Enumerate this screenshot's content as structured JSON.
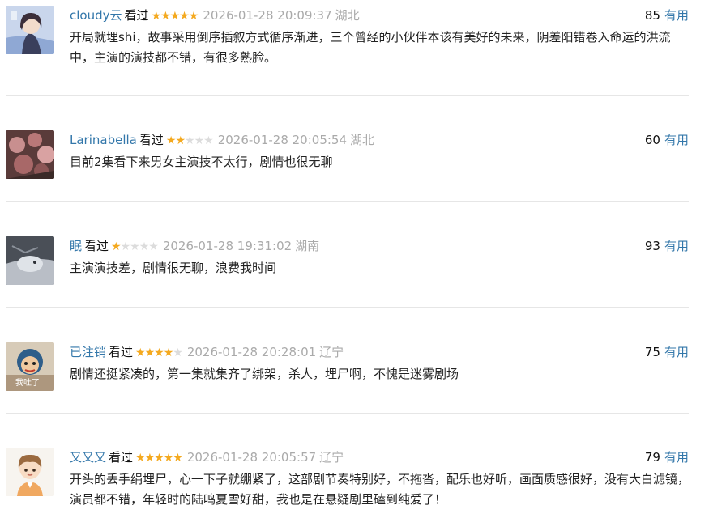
{
  "comments": [
    {
      "user": "cloudy云",
      "watched": "看过",
      "rating": 5,
      "time": "2026-01-28 20:09:37",
      "location": "湖北",
      "votes": "85",
      "useful_label": "有用",
      "content": "开局就埋shi，故事采用倒序插叙方式循序渐进，三个曾经的小伙伴本该有美好的未来，阴差阳错卷入命运的洪流中，主演的演技都不错，有很多熟脸。"
    },
    {
      "user": "Larinabella",
      "watched": "看过",
      "rating": 2,
      "time": "2026-01-28 20:05:54",
      "location": "湖北",
      "votes": "60",
      "useful_label": "有用",
      "content": "目前2集看下来男女主演技不太行，剧情也很无聊"
    },
    {
      "user": "眠",
      "watched": "看过",
      "rating": 1,
      "time": "2026-01-28 19:31:02",
      "location": "湖南",
      "votes": "93",
      "useful_label": "有用",
      "content": "主演演技差，剧情很无聊，浪费我时间"
    },
    {
      "user": "已注销",
      "watched": "看过",
      "rating": 4,
      "time": "2026-01-28 20:28:01",
      "location": "辽宁",
      "votes": "75",
      "useful_label": "有用",
      "content": "剧情还挺紧凑的，第一集就集齐了绑架，杀人，埋尸啊，不愧是迷雾剧场"
    },
    {
      "user": "又又又",
      "watched": "看过",
      "rating": 5,
      "time": "2026-01-28 20:05:57",
      "location": "辽宁",
      "votes": "79",
      "useful_label": "有用",
      "content": "开头的丢手绢埋尸，心一下子就绷紧了，这部剧节奏特别好，不拖沓，配乐也好听，画面质感很好，没有大白滤镜，演员都不错，年轻时的陆鸣夏雪好甜，我也是在悬疑剧里磕到纯爱了！"
    }
  ],
  "avatar_text": {
    "user4": "我吐了"
  },
  "colors": {
    "username": "#3377aa",
    "star_on": "#f4a91f",
    "star_off": "#dcdcdc",
    "meta_gray": "#aaaaaa",
    "divider": "#e6e6e6"
  },
  "icons": {
    "star": "star-icon"
  }
}
